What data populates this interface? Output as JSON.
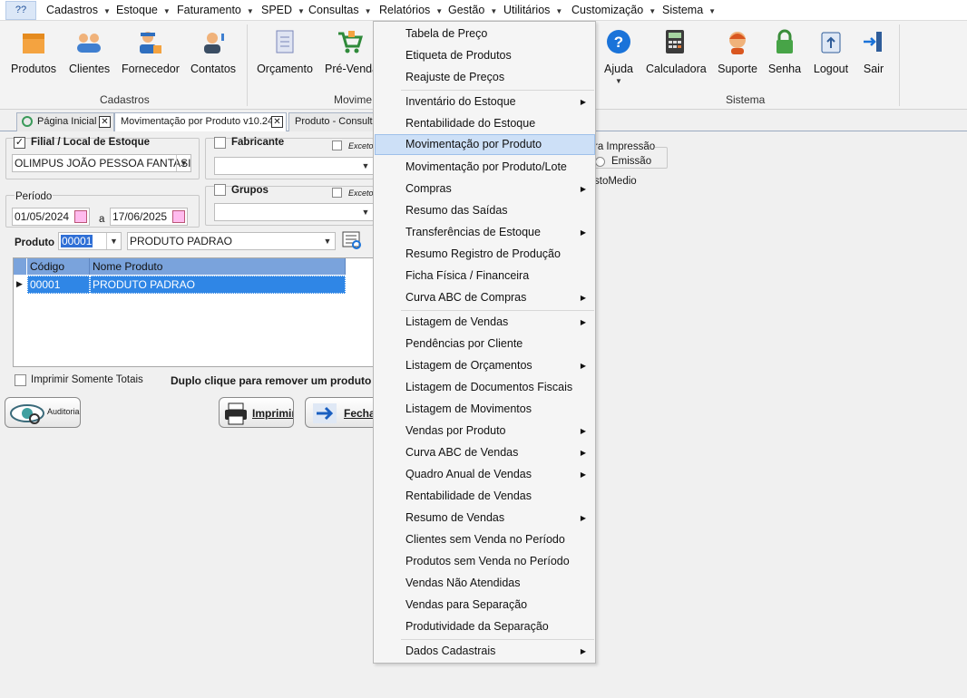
{
  "menubar": {
    "app_icon": "??",
    "items": [
      {
        "label": "Cadastros"
      },
      {
        "label": "Estoque"
      },
      {
        "label": "Faturamento"
      },
      {
        "label": "SPED"
      },
      {
        "label": "Consultas"
      },
      {
        "label": "Relatórios"
      },
      {
        "label": "Gestão"
      },
      {
        "label": "Utilitários"
      },
      {
        "label": "Customização"
      },
      {
        "label": "Sistema"
      }
    ]
  },
  "ribbon": {
    "buttons": {
      "produtos": "Produtos",
      "clientes": "Clientes",
      "fornecedor": "Fornecedor",
      "contatos": "Contatos",
      "orcamento": "Orçamento",
      "prevenda": "Pré-Venda",
      "ajuda": "Ajuda",
      "calculadora": "Calculadora",
      "suporte": "Suporte",
      "senha": "Senha",
      "logout": "Logout",
      "sair": "Sair"
    },
    "groups": {
      "cadastros": "Cadastros",
      "movimento": "Movime",
      "sistema": "Sistema"
    }
  },
  "tabs": {
    "home": "Página Inicial",
    "movimentacao": "Movimentação por Produto v10.24",
    "consulta": "Produto - Consult"
  },
  "form": {
    "filial_label": "Filial / Local de Estoque",
    "filial_value": "OLIMPUS JOÃO PESSOA FANTASIA",
    "fabricante_label": "Fabricante",
    "exceto_label": "Exceto",
    "grupos_label": "Grupos",
    "periodo_label": "Período",
    "date_from": "01/05/2024",
    "date_sep": "a",
    "date_to": "17/06/2025",
    "impressao_label": "ra Impressão",
    "emissao_label": "Emissão",
    "custo_label": "stoMedio",
    "produto_label": "Produto",
    "produto_code": "00001",
    "produto_name": "PRODUTO PADRAO",
    "grid_headers": {
      "codigo": "Código",
      "nome": "Nome Produto"
    },
    "grid_rows": [
      {
        "codigo": "00001",
        "nome": "PRODUTO PADRAO"
      }
    ],
    "imprimir_totais": "Imprimir Somente Totais",
    "hint": "Duplo clique para remover um produto",
    "auditoria": "Auditoria",
    "imprimir": "Imprimir",
    "fechar": "Fechar"
  },
  "relatorios_menu": {
    "items": [
      {
        "label": "Tabela de Preço"
      },
      {
        "label": "Etiqueta de Produtos"
      },
      {
        "label": "Reajuste de Preços"
      },
      {
        "label": "Inventário do Estoque"
      },
      {
        "label": "Rentabilidade do Estoque"
      },
      {
        "label": "Movimentação por Produto"
      },
      {
        "label": "Movimentação por Produto/Lote"
      },
      {
        "label": "Compras"
      },
      {
        "label": "Resumo das Saídas"
      },
      {
        "label": "Transferências de Estoque"
      },
      {
        "label": "Resumo Registro de Produção"
      },
      {
        "label": "Ficha Física / Financeira"
      },
      {
        "label": "Curva ABC de Compras"
      },
      {
        "label": "Listagem de Vendas"
      },
      {
        "label": "Pendências por Cliente"
      },
      {
        "label": "Listagem de Orçamentos"
      },
      {
        "label": "Listagem de Documentos Fiscais"
      },
      {
        "label": "Listagem de Movimentos"
      },
      {
        "label": "Vendas por Produto"
      },
      {
        "label": "Curva ABC de Vendas"
      },
      {
        "label": "Quadro Anual de Vendas"
      },
      {
        "label": "Rentabilidade de Vendas"
      },
      {
        "label": "Resumo de Vendas"
      },
      {
        "label": "Clientes sem Venda no Período"
      },
      {
        "label": "Produtos sem Venda no Período"
      },
      {
        "label": "Vendas Não Atendidas"
      },
      {
        "label": "Vendas para Separação"
      },
      {
        "label": "Produtividade da Separação"
      },
      {
        "label": "Dados Cadastrais"
      }
    ],
    "selected": "Movimentação por Produto"
  }
}
